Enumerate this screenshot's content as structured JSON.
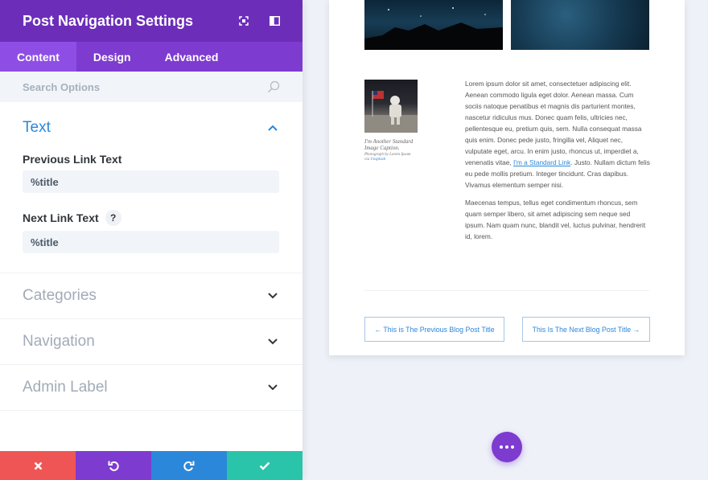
{
  "header": {
    "title": "Post Navigation Settings"
  },
  "tabs": [
    {
      "label": "Content",
      "active": true
    },
    {
      "label": "Design",
      "active": false
    },
    {
      "label": "Advanced",
      "active": false
    }
  ],
  "search": {
    "placeholder": "Search Options"
  },
  "sections": {
    "text": {
      "title": "Text",
      "previous_label": "Previous Link Text",
      "previous_value": "%title",
      "next_label": "Next Link Text",
      "next_help": "?",
      "next_value": "%title"
    },
    "categories": "Categories",
    "navigation": "Navigation",
    "admin_label": "Admin Label"
  },
  "footer": {
    "colors": {
      "discard": "#ef5555",
      "undo": "#7e3bd0",
      "redo": "#2b87da",
      "save": "#29c4a9"
    }
  },
  "preview": {
    "caption": "I'm Another Standard Image Caption.",
    "caption_credit_prefix": "Photograph by Lorem Ipsum via ",
    "caption_credit_link": "Unsplash",
    "para1_a": "Lorem ipsum dolor sit amet, consectetuer adipiscing elit. Aenean commodo ligula eget dolor. Aenean massa. Cum sociis natoque penatibus et magnis dis parturient montes, nascetur ridiculus mus. Donec quam felis, ultricies nec, pellentesque eu, pretium quis, sem. Nulla consequat massa quis enim. Donec pede justo, fringilla vel, Aliquet nec, vulputate eget, arcu. In enim justo, rhoncus ut, imperdiet a, venenatis vitae, ",
    "para1_link": "I'm a Standard Link",
    "para1_b": ". Justo. Nullam dictum felis eu pede mollis pretium. Integer tincidunt. Cras dapibus. Vivamus elementum semper nisi.",
    "para2": "Maecenas tempus, tellus eget condimentum rhoncus, sem quam semper libero, sit amet adipiscing sem neque sed ipsum. Nam quam nunc, blandit vel, luctus pulvinar, hendrerit id, lorem.",
    "prev_post": "← This is The Previous Blog Post Title",
    "next_post": "This Is The Next Blog Post Title →"
  },
  "colors": {
    "accent": "#7e3bd0",
    "header": "#6c2eb9",
    "link": "#2b87da"
  }
}
